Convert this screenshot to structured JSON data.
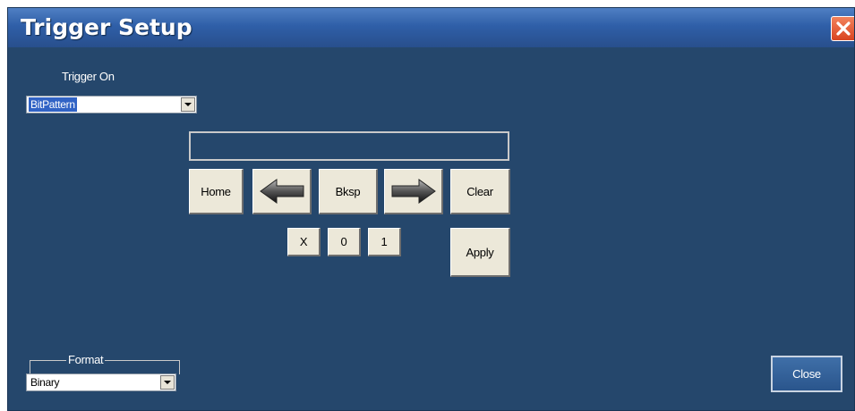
{
  "window": {
    "title": "Trigger Setup",
    "close_icon": "close-icon"
  },
  "trigger_on": {
    "label": "Trigger On",
    "value": "BitPattern"
  },
  "pattern_input": {
    "value": ""
  },
  "keypad": {
    "home": "Home",
    "left_icon": "arrow-left-icon",
    "bksp": "Bksp",
    "right_icon": "arrow-right-icon",
    "clear": "Clear",
    "x": "X",
    "zero": "0",
    "one": "1",
    "apply": "Apply"
  },
  "format": {
    "label": "Format",
    "value": "Binary"
  },
  "footer": {
    "close": "Close"
  },
  "colors": {
    "dialog_bg": "#25476c",
    "titlebar": "#2f5fa8",
    "button_face": "#ece8d9",
    "selection": "#3163c5",
    "close_x": "#d94420"
  }
}
